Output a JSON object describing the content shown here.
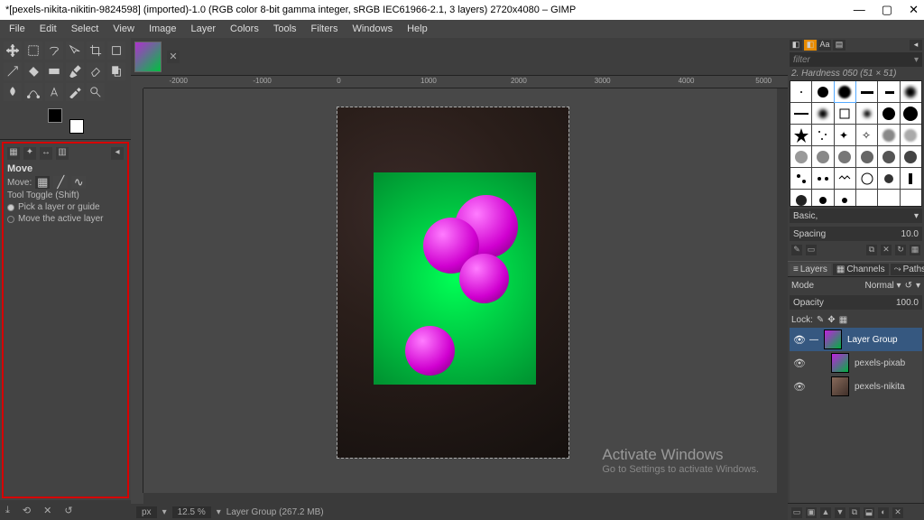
{
  "titlebar": {
    "title": "*[pexels-nikita-nikitin-9824598] (imported)-1.0 (RGB color 8-bit gamma integer, sRGB IEC61966-2.1, 3 layers) 2720x4080 – GIMP"
  },
  "menu": [
    "File",
    "Edit",
    "Select",
    "View",
    "Image",
    "Layer",
    "Colors",
    "Tools",
    "Filters",
    "Windows",
    "Help"
  ],
  "toolopts": {
    "title": "Move",
    "move_label": "Move:",
    "toggle_label": "Tool Toggle  (Shift)",
    "opt1": "Pick a layer or guide",
    "opt2": "Move the active layer"
  },
  "ruler_marks": [
    "-2000",
    "-1000",
    "0",
    "1000",
    "2000",
    "3000",
    "4000",
    "5000"
  ],
  "status": {
    "unit": "px",
    "zoom": "12.5 %",
    "layer": "Layer Group (267.2 MB)"
  },
  "right": {
    "filter_placeholder": "filter",
    "brush_name": "2. Hardness 050 (51 × 51)",
    "preset_label": "Basic,",
    "spacing_label": "Spacing",
    "spacing_val": "10.0",
    "tabs": {
      "layers": "Layers",
      "channels": "Channels",
      "paths": "Paths"
    },
    "mode_label": "Mode",
    "mode_val": "Normal",
    "opacity_label": "Opacity",
    "opacity_val": "100.0",
    "lock_label": "Lock:",
    "layers": [
      {
        "name": "Layer Group",
        "indent": 0,
        "sel": true,
        "thumb": "grp"
      },
      {
        "name": "pexels-pixab",
        "indent": 1,
        "sel": false,
        "thumb": "top"
      },
      {
        "name": "pexels-nikita",
        "indent": 1,
        "sel": false,
        "thumb": "bot"
      }
    ]
  },
  "activate": {
    "h": "Activate Windows",
    "p": "Go to Settings to activate Windows."
  }
}
